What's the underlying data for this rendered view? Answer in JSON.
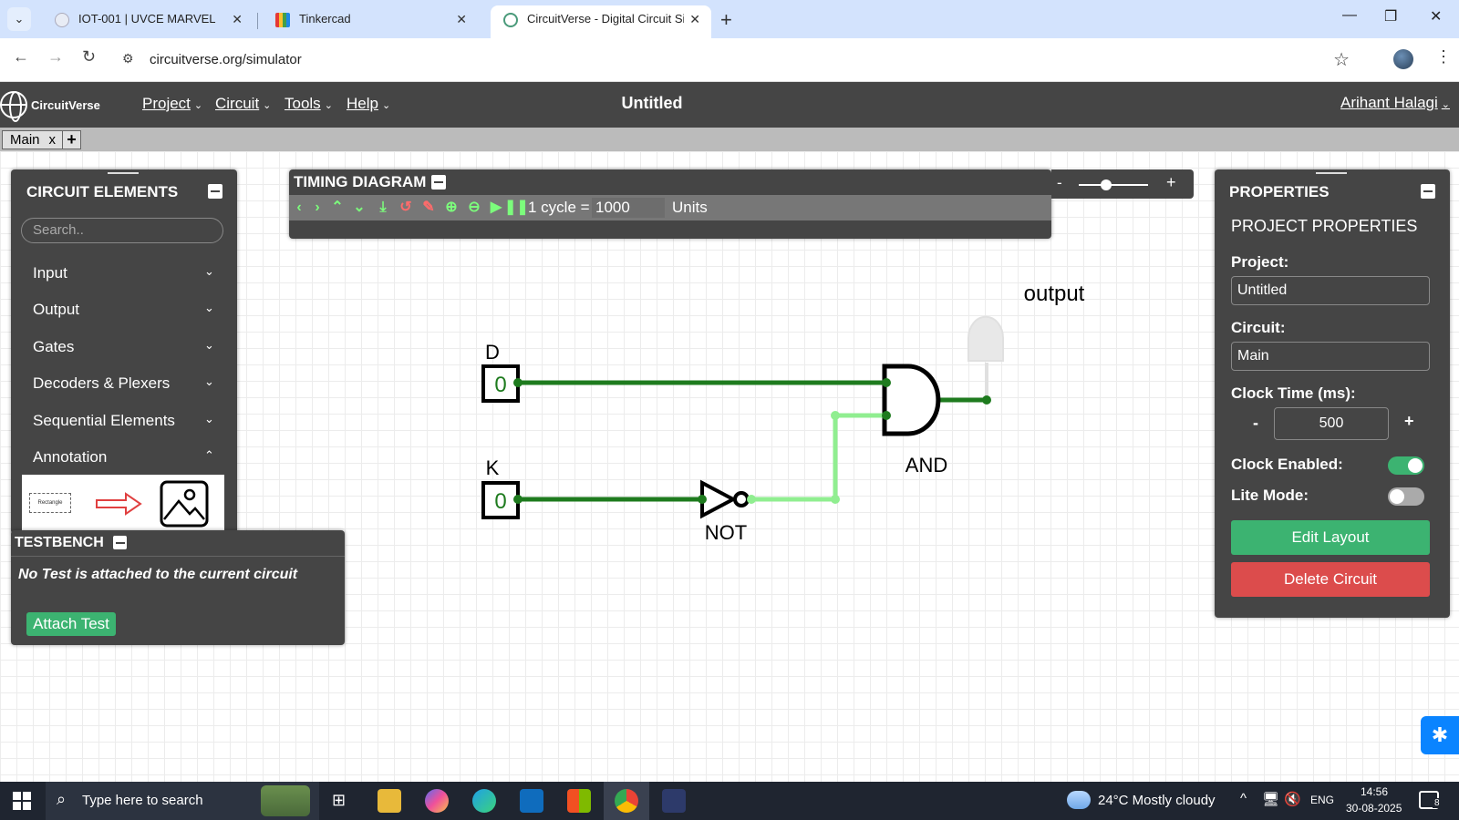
{
  "browser": {
    "tabs": [
      {
        "title": "IOT-001 | UVCE MARVEL",
        "active": false
      },
      {
        "title": "Tinkercad",
        "active": false
      },
      {
        "title": "CircuitVerse - Digital Circuit Sim",
        "active": true
      }
    ],
    "url": "circuitverse.org/simulator",
    "icons": {
      "back": "back-arrow-icon",
      "forward": "forward-arrow-icon",
      "reload": "reload-icon",
      "site_info": "site-settings-icon",
      "bookmark": "star-icon",
      "menu": "kebab-menu-icon",
      "minimize": "minimize-icon",
      "restore": "restore-icon",
      "close": "close-icon"
    }
  },
  "app": {
    "logo_text": "CircuitVerse",
    "menus": [
      "Project",
      "Circuit",
      "Tools",
      "Help"
    ],
    "project_title": "Untitled",
    "user": "Arihant Halagi",
    "circuit_tab": "Main",
    "circuit_tab_close": "x",
    "add_tab": "+"
  },
  "elements_panel": {
    "title": "CIRCUIT ELEMENTS",
    "search_placeholder": "Search..",
    "categories": [
      {
        "label": "Input",
        "expanded": false
      },
      {
        "label": "Output",
        "expanded": false
      },
      {
        "label": "Gates",
        "expanded": false
      },
      {
        "label": "Decoders & Plexers",
        "expanded": false
      },
      {
        "label": "Sequential Elements",
        "expanded": false
      },
      {
        "label": "Annotation",
        "expanded": true
      }
    ],
    "annotation_items": [
      "Rectangle",
      "arrow-icon",
      "image-icon"
    ]
  },
  "timing": {
    "title": "TIMING DIAGRAM",
    "cycle_label": "1 cycle =",
    "cycle_value": "1000",
    "units_label": "Units",
    "zoom_minus": "-",
    "zoom_plus": "+"
  },
  "circuit": {
    "inputs": [
      {
        "label": "D",
        "value": "0"
      },
      {
        "label": "K",
        "value": "0"
      }
    ],
    "gates": [
      {
        "label": "NOT"
      },
      {
        "label": "AND"
      }
    ],
    "output_label": "output",
    "colors": {
      "wire_low": "#1e7b1e",
      "wire_high": "#90ee90",
      "led_off": "#e8e8e8"
    }
  },
  "properties": {
    "title": "PROPERTIES",
    "section": "PROJECT PROPERTIES",
    "project_label": "Project:",
    "project_value": "Untitled",
    "circuit_label": "Circuit:",
    "circuit_value": "Main",
    "clock_label": "Clock Time (ms):",
    "clock_minus": "-",
    "clock_value": "500",
    "clock_plus": "+",
    "clock_enabled_label": "Clock Enabled:",
    "clock_enabled": true,
    "lite_mode_label": "Lite Mode:",
    "lite_mode": false,
    "edit_layout": "Edit Layout",
    "delete_circuit": "Delete Circuit",
    "colors": {
      "edit": "#3cb371",
      "delete": "#dc4c4c",
      "toggle_on": "#3cb371"
    }
  },
  "testbench": {
    "title": "TESTBENCH",
    "message": "No Test is attached to the current circuit",
    "attach": "Attach Test"
  },
  "taskbar": {
    "search_placeholder": "Type here to search",
    "weather": "24°C  Mostly cloudy",
    "language": "ENG",
    "time": "14:56",
    "date": "30-08-2025",
    "notifications": "8"
  }
}
